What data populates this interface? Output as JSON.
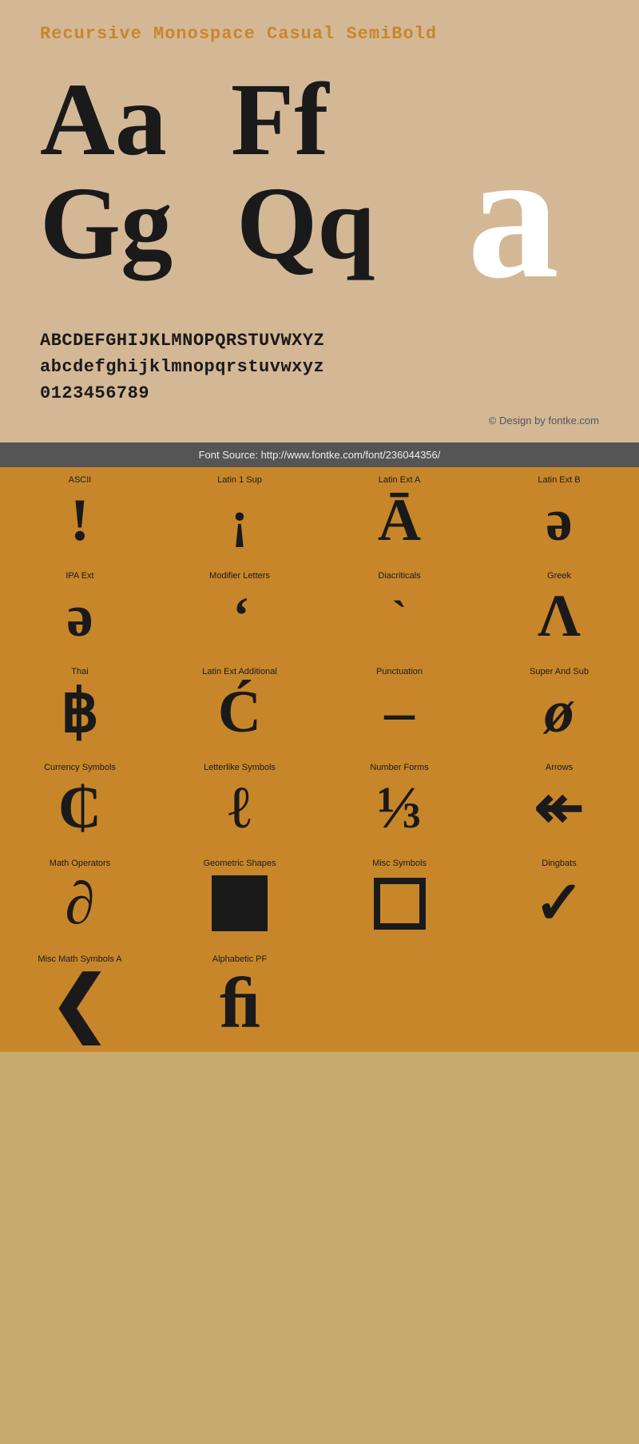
{
  "header": {
    "title": "Recursive Monospace Casual SemiBold",
    "bg_color": "#d4b896",
    "title_color": "#c8862a"
  },
  "large_chars": {
    "row1": [
      "Aa",
      "Ff"
    ],
    "row2": [
      "Gg",
      "Qq"
    ],
    "watermark": "a"
  },
  "alphabet": {
    "uppercase": "ABCDEFGHIJKLMNOPQRSTUVWXYZ",
    "lowercase": "abcdefghijklmnopqrstuvwxyz",
    "digits": "0123456789"
  },
  "copyright": "© Design by fontke.com",
  "font_source": "Font Source: http://www.fontke.com/font/236044356/",
  "glyph_rows": [
    {
      "cells": [
        {
          "label": "ASCII",
          "char": "!"
        },
        {
          "label": "Latin 1 Sup",
          "char": "¡"
        },
        {
          "label": "Latin Ext A",
          "char": "Ā"
        },
        {
          "label": "Latin Ext B",
          "char": "ə"
        }
      ]
    },
    {
      "cells": [
        {
          "label": "IPA Ext",
          "char": "ə"
        },
        {
          "label": "Modifier Letters",
          "char": "ʼ"
        },
        {
          "label": "Diacriticals",
          "char": "`"
        },
        {
          "label": "Greek",
          "char": "Λ"
        }
      ]
    },
    {
      "cells": [
        {
          "label": "Thai",
          "char": "฿"
        },
        {
          "label": "Latin Ext Additional",
          "char": "Ć"
        },
        {
          "label": "Punctuation",
          "char": "–"
        },
        {
          "label": "Super And Sub",
          "char": "ø"
        }
      ]
    },
    {
      "cells": [
        {
          "label": "Currency Symbols",
          "char": "₵"
        },
        {
          "label": "Letterlike Symbols",
          "char": "ℓ"
        },
        {
          "label": "Number Forms",
          "char": "⅓"
        },
        {
          "label": "Arrows",
          "char": "↜"
        }
      ]
    },
    {
      "cells": [
        {
          "label": "Math Operators",
          "char": "∂"
        },
        {
          "label": "Geometric Shapes",
          "char": "■"
        },
        {
          "label": "Misc Symbols",
          "char": "□"
        },
        {
          "label": "Dingbats",
          "char": "✓"
        }
      ]
    },
    {
      "cells": [
        {
          "label": "Misc Math Symbols A",
          "char": "〈"
        },
        {
          "label": "Alphabetic PF",
          "char": "ﬁ"
        },
        {
          "label": "",
          "char": ""
        },
        {
          "label": "",
          "char": ""
        }
      ]
    }
  ]
}
